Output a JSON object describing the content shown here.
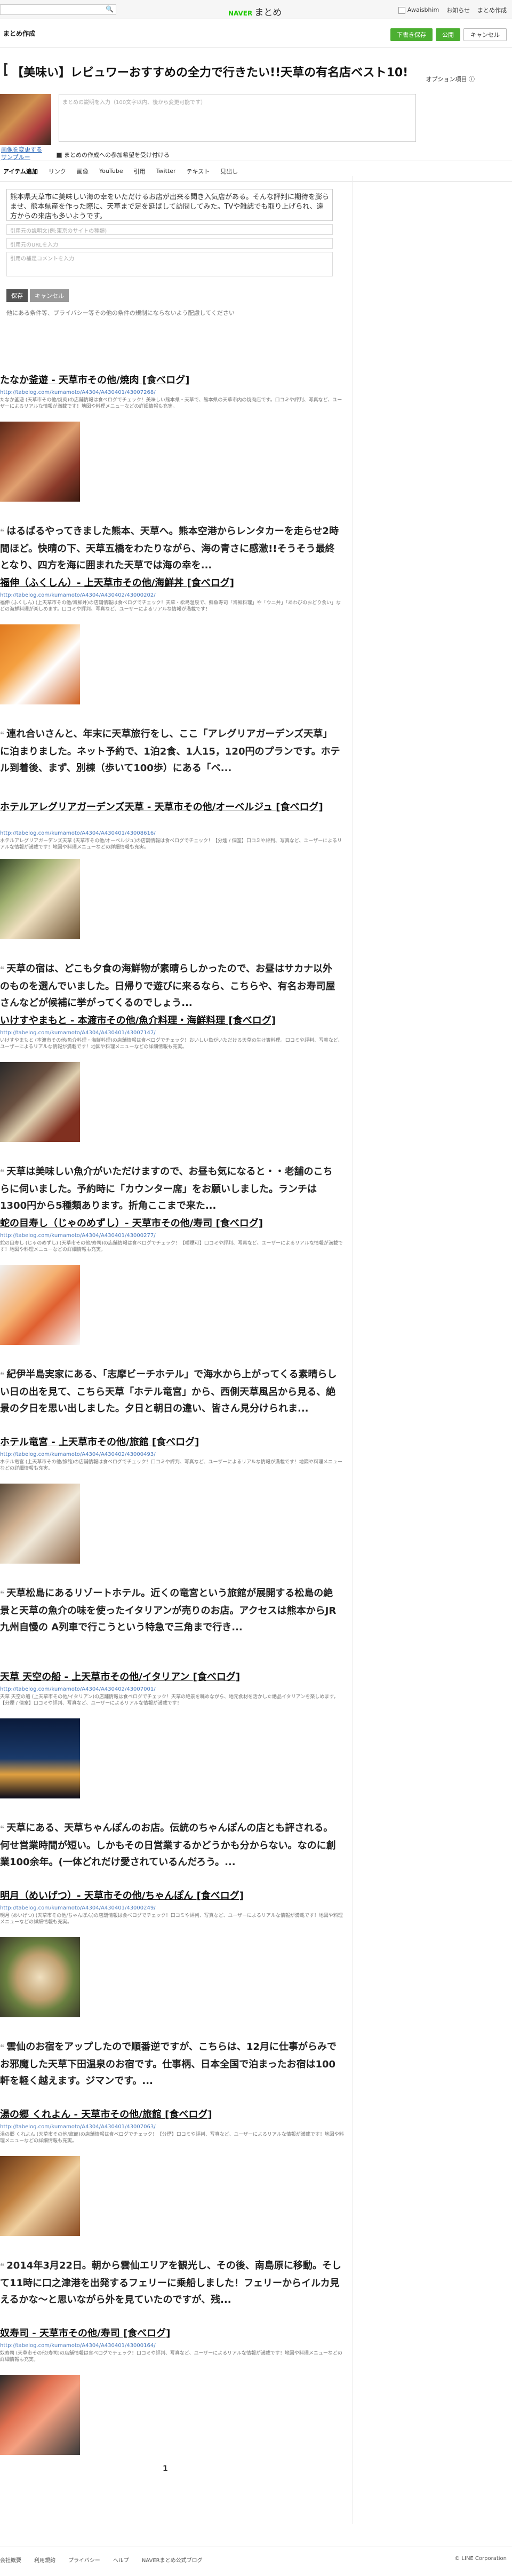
{
  "header": {
    "logo_brand": "NAVER",
    "logo_text": "まとめ",
    "links": [
      "Awaisbhim",
      "お知らせ",
      "まとめ作成"
    ]
  },
  "subbar": {
    "title": "まとめ作成",
    "buttons": [
      "下書き保存",
      "公開",
      "キャンセル"
    ]
  },
  "editor": {
    "main_title": "【美味い】レビュワーおすすめの全力で行きたい!!天草の有名店ベスト10!",
    "option_link": "オプション項目 ⓘ",
    "change_thumb": "画像を変更する",
    "change_thumb2": "サンプルー",
    "desc_placeholder": "まとめの説明を入力（100文字以内、後から変更可能です）",
    "notify_label": "まとめの作成への参加希望を受け付ける"
  },
  "tabs": [
    "アイテム追加",
    "リンク",
    "画像",
    "YouTube",
    "引用",
    "Twitter",
    "テキスト",
    "見出し"
  ],
  "form": {
    "textarea": "熊本県天草市に美味しい海の幸をいただけるお店が出来る聞き入気店がある。そんな評判に期待を膨らませ、熊本県産を作った際に、天草まで足を延ばして訪問してみた。TVや雑誌でも取り上げられ、遠方からの来店も多いようです。",
    "url_placeholder": "引用元の説明文(例:東京のサイトの種類)",
    "source_placeholder": "引用元のURLを入力",
    "comment_placeholder": "引用の補足コメントを入力",
    "buttons": [
      "保存",
      "キャンセル"
    ],
    "note": "他にある条件等、プライバシー等その他の条件の規制にならないよう配慮してください"
  },
  "cards": [
    {
      "title": "たなか釜遊 - 天草市その他/焼肉 [食べログ]",
      "url": "http://tabelog.com/kumamoto/A4304/A430401/43007268/",
      "desc": "たなか釜遊 (天草市その他/焼肉)の店舗情報は食べログでチェック！美味しい熊本県・天草で、熊本県の天草市内の焼肉店です。口コミや評判、写真など、ユーザーによるリアルな情報が満載です！地図や料理メニューなどの詳細情報も充実。",
      "quote": "はるばるやってきました熊本、天草へ。熊本空港からレンタカーを走らせ2時間ほど。快晴の下、天草五橋をわたりながら、海の青さに感激!!そうそう最終となり、四方を海に囲まれた天草では海の幸を..."
    },
    {
      "title": "福伸（ふくしん）- 上天草市その他/海鮮丼 [食べログ]",
      "url": "http://tabelog.com/kumamoto/A4304/A430402/43000202/",
      "desc": "福伸 (ふくしん) (上天草市その他/海鮮丼)の店舗情報は食べログでチェック！天草・松島温泉で、鮮魚寿司「海鮮料理」や「ウニ丼」「あわびのおどり食い」などの海鮮料理が楽しめます。口コミや評判、写真など、ユーザーによるリアルな情報が満載です！",
      "quote": "連れ合いさんと、年末に天草旅行をし、ここ「アレグリアガーデンズ天草」に泊まりました。ネット予約で、1泊2食、1人15，120円のプランです。ホテル到着後、まず、別棟（歩いて100歩）にある「ベ..."
    },
    {
      "title": "ホテルアレグリアガーデンズ天草 - 天草市その他/オーベルジュ [食べログ]",
      "url": "http://tabelog.com/kumamoto/A4304/A430401/43008616/",
      "desc": "ホテルアレグリアガーデンズ天草 (天草市その他/オーベルジュ)の店舗情報は食べログでチェック！【分煙 / 個室】口コミや評判、写真など、ユーザーによるリアルな情報が満載です！地図や料理メニューなどの詳細情報も充実。",
      "quote": "天草の宿は、どこも夕食の海鮮物が素晴らしかったので、お昼はサカナ以外のものを選んでいました。日帰りで遊びに来るなら、こちらや、有名お寿司屋さんなどが候補に挙がってくるのでしょう..."
    },
    {
      "title": "いけすやまもと - 本渡市その他/魚介料理・海鮮料理 [食べログ]",
      "url": "http://tabelog.com/kumamoto/A4304/A430401/43007147/",
      "desc": "いけすやまもと (本渡市その他/魚介料理・海鮮料理)の店舗情報は食べログでチェック！おいしい魚がいただける天草の生け簀料理。口コミや評判、写真など、ユーザーによるリアルな情報が満載です！地図や料理メニューなどの詳細情報も充実。",
      "quote": "天草は美味しい魚介がいただけますので、お昼も気になると・・老舗のこちらに伺いました。予約時に「カウンター席」をお願いしました。ランチは1300円から5種類あります。折角ここまで来た..."
    },
    {
      "title": "蛇の目寿し（じゃのめずし）- 天草市その他/寿司 [食べログ]",
      "url": "http://tabelog.com/kumamoto/A4304/A430401/43000277/",
      "desc": "蛇の目寿し (じゃのめずし) (天草市その他/寿司)の店舗情報は食べログでチェック！【喫煙可】口コミや評判、写真など、ユーザーによるリアルな情報が満載です！地図や料理メニューなどの詳細情報も充実。",
      "quote": "紀伊半島実家にある、「志摩ビーチホテル」で海水から上がってくる素晴らしい日の出を見て、こちら天草「ホテル竜宮」から、西側天草風呂から見る、絶景の夕日を思い出しました。夕日と朝日の違い、皆さん見分けられま..."
    },
    {
      "title": "ホテル竜宮 - 上天草市その他/旅館 [食べログ]",
      "url": "http://tabelog.com/kumamoto/A4304/A430402/43000493/",
      "desc": "ホテル竜宮 (上天草市その他/旅館)の店舗情報は食べログでチェック！口コミや評判、写真など、ユーザーによるリアルな情報が満載です！地図や料理メニューなどの詳細情報も充実。",
      "quote": "天草松島にあるリゾートホテル。近くの竜宮という旅館が展開する松島の絶景と天草の魚介の味を使ったイタリアンが売りのお店。アクセスは熊本からJR九州自慢の A列車で行こうという特急で三角まで行き..."
    },
    {
      "title": "天草 天空の船 - 上天草市その他/イタリアン [食べログ]",
      "url": "http://tabelog.com/kumamoto/A4304/A430402/43007001/",
      "desc": "天草 天空の船 (上天草市その他/イタリアン)の店舗情報は食べログでチェック！天草の絶景を眺めながら、地元食材を活かした絶品イタリアンを楽しめます。【分煙 / 個室】口コミや評判、写真など、ユーザーによるリアルな情報が満載です！",
      "quote": "天草にある、天草ちゃんぽんのお店。伝統のちゃんぽんの店とも評される。何せ営業時間が短い。しかもその日営業するかどうかも分からない。なのに創業100余年。(一体どれだけ愛されているんだろう。..."
    },
    {
      "title": "明月（めいげつ）- 天草市その他/ちゃんぽん [食べログ]",
      "url": "http://tabelog.com/kumamoto/A4304/A430401/43000249/",
      "desc": "明月 (めいげつ) (天草市その他/ちゃんぽん)の店舗情報は食べログでチェック！口コミや評判、写真など、ユーザーによるリアルな情報が満載です！地図や料理メニューなどの詳細情報も充実。",
      "quote": "雲仙のお宿をアップしたので順番逆ですが、こちらは、12月に仕事がらみでお邪魔した天草下田温泉のお宿です。仕事柄、日本全国で泊まったお宿は100軒を軽く越えます。ジマンです。..."
    },
    {
      "title": "湯の郷 くれよん - 天草市その他/旅館 [食べログ]",
      "url": "http://tabelog.com/kumamoto/A4304/A430401/43007063/",
      "desc": "湯の郷 くれよん (天草市その他/旅館)の店舗情報は食べログでチェック！【分煙】口コミや評判、写真など、ユーザーによるリアルな情報が満載です！地図や料理メニューなどの詳細情報も充実。",
      "quote": "2014年3月22日。朝から雲仙エリアを観光し、その後、南島原に移動。そして11時に口之津港を出発するフェリーに乗船しました！フェリーからイルカ見えるかな〜と思いながら外を見ていたのですが、残..."
    },
    {
      "title": "奴寿司 - 天草市その他/寿司 [食べログ]",
      "url": "http://tabelog.com/kumamoto/A4304/A430401/43000164/",
      "desc": "奴寿司 (天草市その他/寿司)の店舗情報は食べログでチェック！口コミや評判、写真など、ユーザーによるリアルな情報が満載です！地図や料理メニューなどの詳細情報も充実。",
      "quote": ""
    }
  ],
  "pager": "1",
  "footer": {
    "links": [
      "会社概要",
      "利用規約",
      "プライバシー",
      "ヘルプ",
      "NAVERまとめ公式ブログ"
    ],
    "copyright": "© LINE Corporation"
  }
}
